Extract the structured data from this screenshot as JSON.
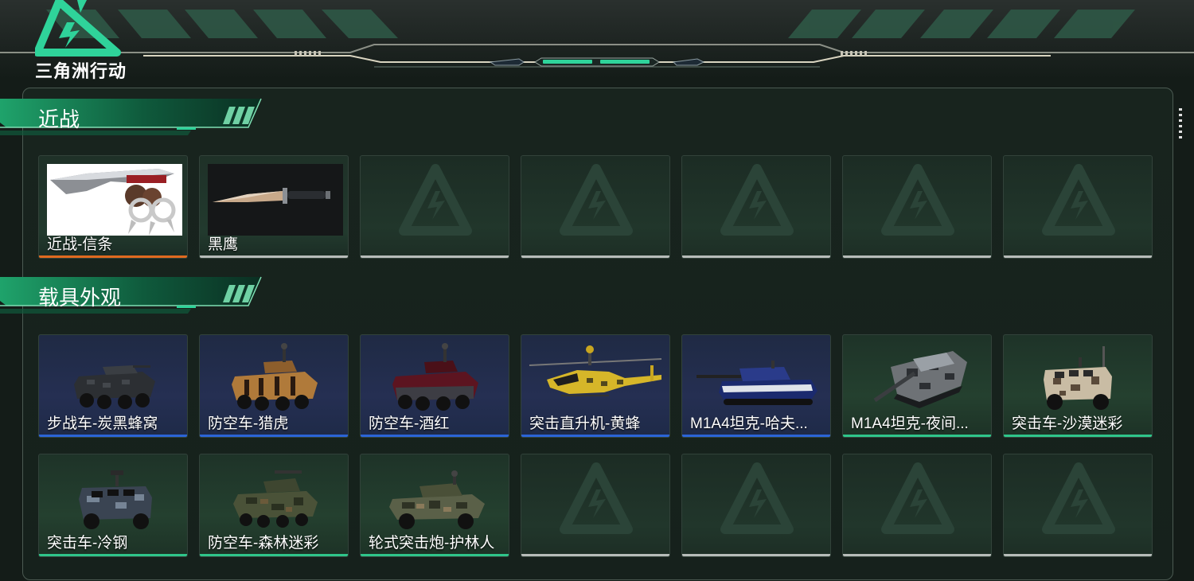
{
  "app": {
    "logo_text": "三角洲行动"
  },
  "sections": [
    {
      "title": "近战",
      "items": [
        {
          "label": "近战-信条",
          "rarity": "orange",
          "icon": "knife-image"
        },
        {
          "label": "黑鹰",
          "rarity": "gray",
          "icon": "combat-knife-image"
        },
        {
          "label": "",
          "rarity": "empty"
        },
        {
          "label": "",
          "rarity": "empty"
        },
        {
          "label": "",
          "rarity": "empty"
        },
        {
          "label": "",
          "rarity": "empty"
        },
        {
          "label": "",
          "rarity": "empty"
        }
      ]
    },
    {
      "title": "载具外观",
      "items": [
        {
          "label": "步战车-炭黑蜂窝",
          "rarity": "blue",
          "icon": "ifv-image"
        },
        {
          "label": "防空车-猎虎",
          "rarity": "blue",
          "icon": "aa-vehicle-image"
        },
        {
          "label": "防空车-酒红",
          "rarity": "blue",
          "icon": "aa-vehicle-image"
        },
        {
          "label": "突击直升机-黄蜂",
          "rarity": "blue",
          "icon": "helicopter-image"
        },
        {
          "label": "M1A4坦克-哈夫...",
          "rarity": "blue",
          "icon": "tank-image"
        },
        {
          "label": "M1A4坦克-夜间...",
          "rarity": "green",
          "icon": "tank-image"
        },
        {
          "label": "突击车-沙漠迷彩",
          "rarity": "green",
          "icon": "assault-vehicle-image"
        },
        {
          "label": "突击车-冷钢",
          "rarity": "green",
          "icon": "assault-vehicle-image"
        },
        {
          "label": "防空车-森林迷彩",
          "rarity": "green",
          "icon": "aa-vehicle-image"
        },
        {
          "label": "轮式突击炮-护林人",
          "rarity": "green",
          "icon": "wheeled-gun-image"
        },
        {
          "label": "",
          "rarity": "empty"
        },
        {
          "label": "",
          "rarity": "empty"
        },
        {
          "label": "",
          "rarity": "empty"
        },
        {
          "label": "",
          "rarity": "empty"
        }
      ]
    }
  ],
  "colors": {
    "accent_green": "#2fc58a",
    "rarity_orange": "#e06a1f",
    "rarity_blue": "#2b64d6",
    "rarity_gray": "#b7bcb9"
  }
}
